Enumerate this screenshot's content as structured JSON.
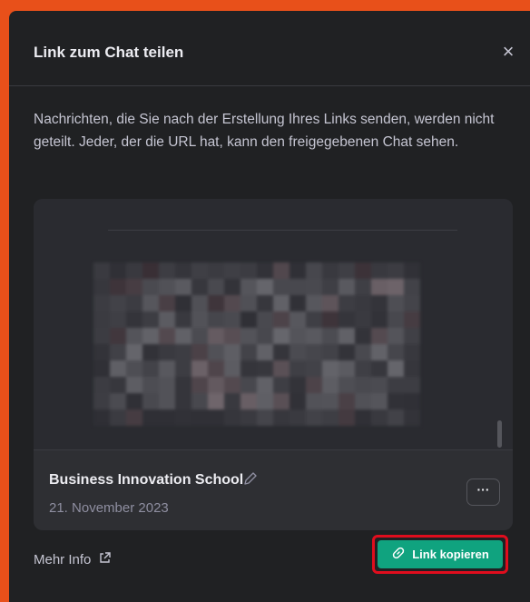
{
  "dialog": {
    "title": "Link zum Chat teilen",
    "close_glyph": "×",
    "description": "Nachrichten, die Sie nach der Erstellung Ihres Links senden, werden nicht geteilt. Jeder, der die URL hat, kann den freigegebenen Chat sehen."
  },
  "card": {
    "chat_title": "Business Innovation School",
    "date": "21. November 2023",
    "more_label": "···",
    "edit_icon": "pencil-icon"
  },
  "footer": {
    "more_info_label": "Mehr Info",
    "more_info_icon": "external-link-icon",
    "copy_label": "Link kopieren",
    "copy_icon": "link-icon"
  },
  "colors": {
    "frame": "#e8501a",
    "dialog_bg": "#202123",
    "accent_green": "#10a37f",
    "highlight_red": "#e00d1d"
  }
}
